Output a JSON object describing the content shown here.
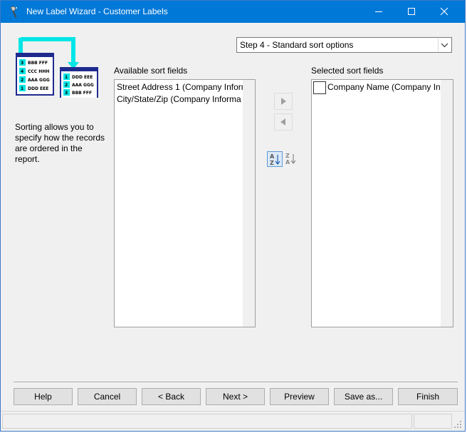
{
  "window": {
    "title": "New Label Wizard - Customer Labels"
  },
  "step_select": {
    "value": "Step 4 - Standard sort options"
  },
  "description": "Sorting allows you to specify how the records are ordered in the report.",
  "available": {
    "label": "Available sort fields",
    "items": [
      "Street Address 1 (Company Inform",
      "City/State/Zip (Company Informa"
    ]
  },
  "selected": {
    "label": "Selected sort fields",
    "items": [
      "Company Name (Company In"
    ]
  },
  "buttons": {
    "help": "Help",
    "cancel": "Cancel",
    "back": "< Back",
    "next": "Next >",
    "preview": "Preview",
    "save_as": "Save as...",
    "finish": "Finish"
  },
  "icons": {
    "title": "wizard-wand-icon",
    "move_right": "triangle-right-icon",
    "move_left": "triangle-left-icon",
    "sort_asc": "sort-ascending-icon",
    "sort_desc": "sort-descending-icon"
  },
  "colors": {
    "titlebar": "#0078d7",
    "accent_cyan": "#00e5e5",
    "doc_blue": "#1f2a8f"
  }
}
